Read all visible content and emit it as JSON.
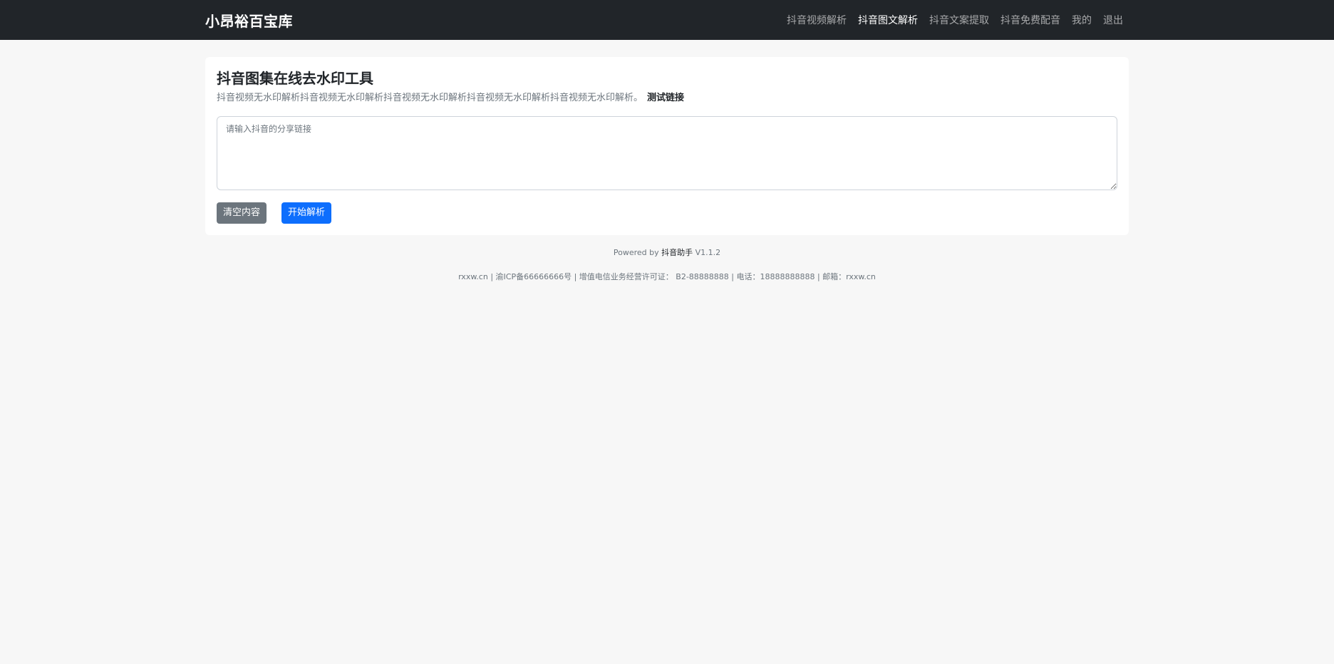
{
  "navbar": {
    "brand": "小昂裕百宝库",
    "links": [
      {
        "label": "抖音视频解析",
        "active": false
      },
      {
        "label": "抖音图文解析",
        "active": true
      },
      {
        "label": "抖音文案提取",
        "active": false
      },
      {
        "label": "抖音免费配音",
        "active": false
      },
      {
        "label": "我的",
        "active": false
      },
      {
        "label": "退出",
        "active": false
      }
    ]
  },
  "main": {
    "title": "抖音图集在线去水印工具",
    "description": "抖音视频无水印解析抖音视频无水印解析抖音视频无水印解析抖音视频无水印解析抖音视频无水印解析。",
    "test_link": "测试链接",
    "input": {
      "placeholder": "请输入抖音的分享链接",
      "value": ""
    },
    "buttons": {
      "clear": "清空内容",
      "parse": "开始解析"
    }
  },
  "footer": {
    "powered_prefix": "Powered by",
    "powered_name": "抖音助手",
    "version": "V1.1.2",
    "icp_line": "rxxw.cn | 渝ICP备66666666号 | 增值电信业务经营许可证： B2-88888888 | 电话：18888888888 | 邮箱：rxxw.cn"
  },
  "colors": {
    "navbar_bg": "#212529",
    "page_bg": "#f7f7f7",
    "primary": "#0d6efd",
    "secondary": "#6c757d"
  }
}
